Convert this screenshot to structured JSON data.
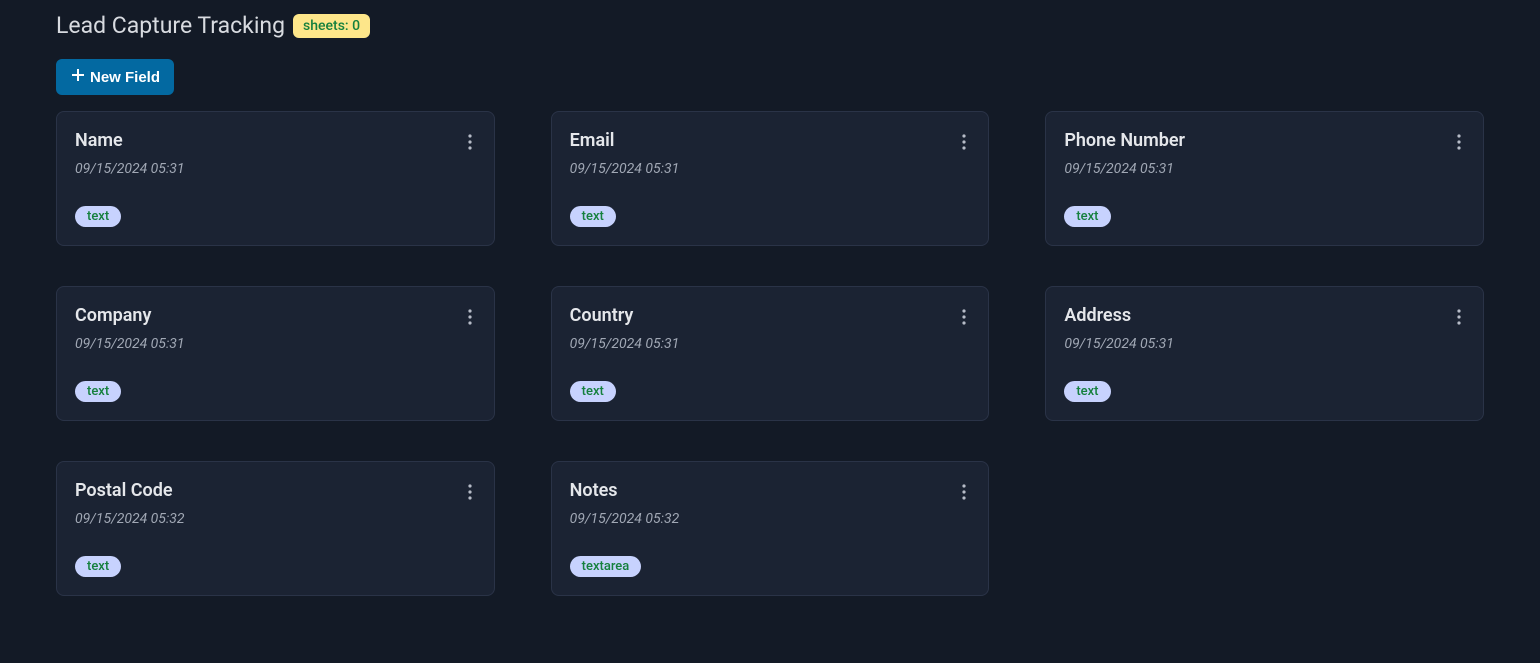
{
  "header": {
    "title": "Lead Capture Tracking",
    "sheets_badge": "sheets: 0"
  },
  "actions": {
    "new_field_label": "New Field"
  },
  "cards": [
    {
      "title": "Name",
      "date": "09/15/2024 05:31",
      "type": "text"
    },
    {
      "title": "Email",
      "date": "09/15/2024 05:31",
      "type": "text"
    },
    {
      "title": "Phone Number",
      "date": "09/15/2024 05:31",
      "type": "text"
    },
    {
      "title": "Company",
      "date": "09/15/2024 05:31",
      "type": "text"
    },
    {
      "title": "Country",
      "date": "09/15/2024 05:31",
      "type": "text"
    },
    {
      "title": "Address",
      "date": "09/15/2024 05:31",
      "type": "text"
    },
    {
      "title": "Postal Code",
      "date": "09/15/2024 05:32",
      "type": "text"
    },
    {
      "title": "Notes",
      "date": "09/15/2024 05:32",
      "type": "textarea"
    }
  ]
}
